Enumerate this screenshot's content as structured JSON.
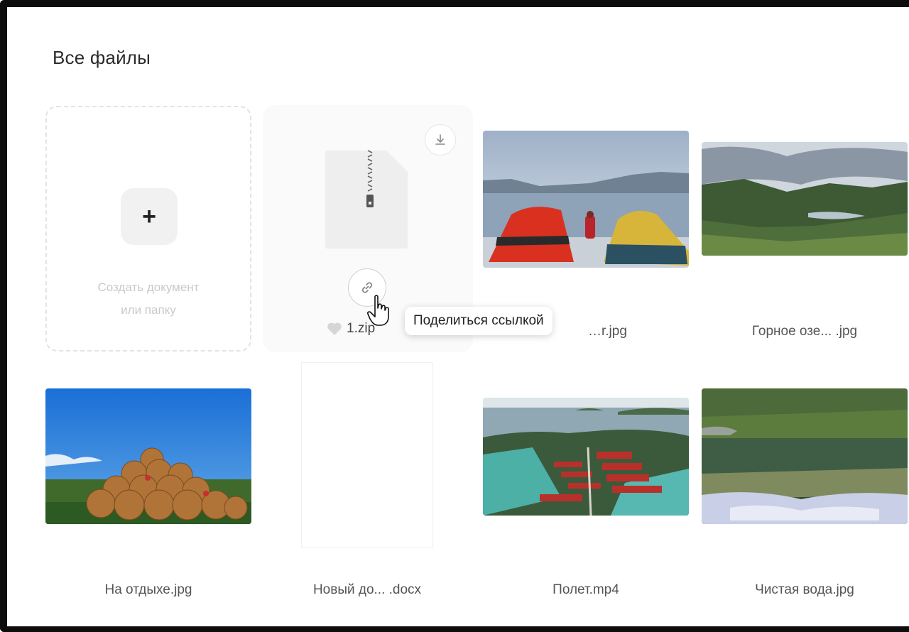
{
  "page": {
    "title": "Все файлы"
  },
  "create_tile": {
    "plus_label": "+",
    "label": "Создать документ\nили папку"
  },
  "files": [
    {
      "name": "1.zip",
      "type": "zip",
      "favorite_icon": "heart-icon",
      "actions": [
        "download-icon",
        "link-icon"
      ]
    },
    {
      "name": "…r.jpg",
      "type": "image",
      "scene": "tents-by-lake"
    },
    {
      "name": "Горное озе... .jpg",
      "type": "image",
      "scene": "mountain-lake"
    },
    {
      "name": "На отдыхе.jpg",
      "type": "image",
      "scene": "hay-bales"
    },
    {
      "name": "Новый до... .docx",
      "type": "docx"
    },
    {
      "name": "Полет.mp4",
      "type": "video",
      "scene": "aerial-marina"
    },
    {
      "name": "Чистая вода.jpg",
      "type": "image",
      "scene": "clear-water"
    }
  ],
  "tooltip": {
    "text": "Поделиться ссылкой"
  },
  "colors": {
    "frame": "#0d0d0d",
    "text": "#2b2b2b",
    "muted": "#c9c9c9"
  }
}
